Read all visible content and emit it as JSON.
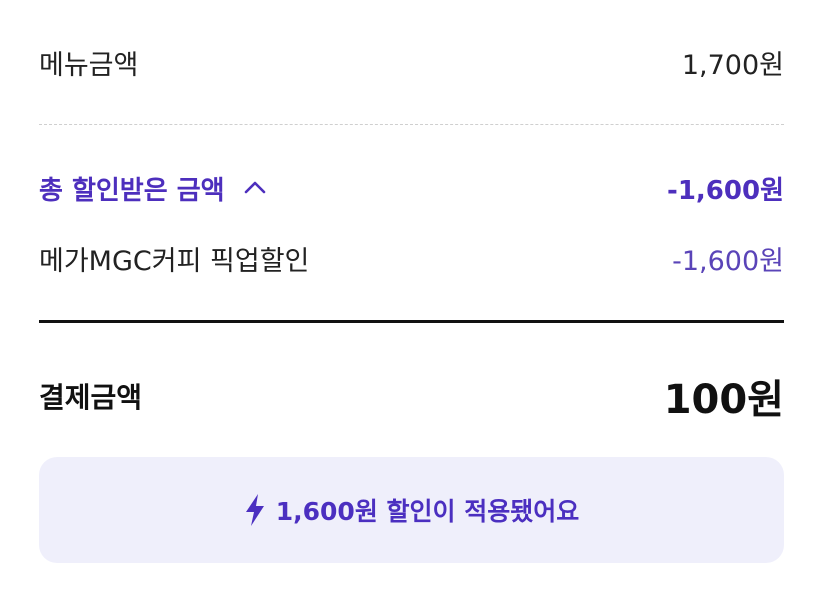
{
  "summary": {
    "menu_label": "메뉴금액",
    "menu_amount": "1,700원",
    "discount_total_label": "총 할인받은 금액",
    "discount_total_amount": "-1,600원",
    "discount_items": [
      {
        "label": "메가MGC커피 픽업할인",
        "amount": "-1,600원"
      }
    ],
    "payment_label": "결제금액",
    "payment_amount": "100원"
  },
  "notice": {
    "text": "1,600원 할인이 적용됐어요",
    "icon": "lightning-icon"
  },
  "colors": {
    "accent": "#4d2fbd",
    "notice_bg": "#efeffb"
  }
}
